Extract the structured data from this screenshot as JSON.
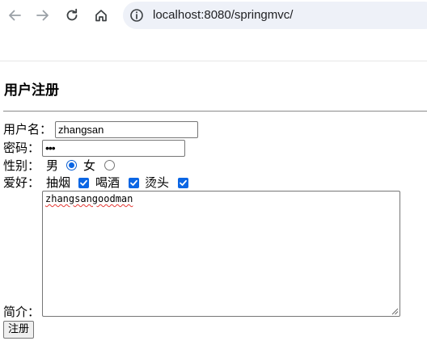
{
  "browser": {
    "url": "localhost:8080/springmvc/"
  },
  "page": {
    "heading": "用户注册"
  },
  "form": {
    "username_label": "用户名：",
    "username_value": "zhangsan",
    "password_label": "密码：",
    "password_mask": "•••",
    "gender_label": "性别：",
    "gender_options": [
      "男",
      "女"
    ],
    "gender_selected": "男",
    "hobby_label": "爱好：",
    "hobbies": [
      {
        "label": "抽烟",
        "checked": true
      },
      {
        "label": "喝酒",
        "checked": true
      },
      {
        "label": "烫头",
        "checked": true
      }
    ],
    "intro_label": "简介：",
    "intro_value": "zhangsangoodman",
    "submit_label": "注册"
  },
  "colors": {
    "accent": "#0b66e4",
    "omnibox_bg": "#eef1f8",
    "spellcheck": "#e53935"
  }
}
